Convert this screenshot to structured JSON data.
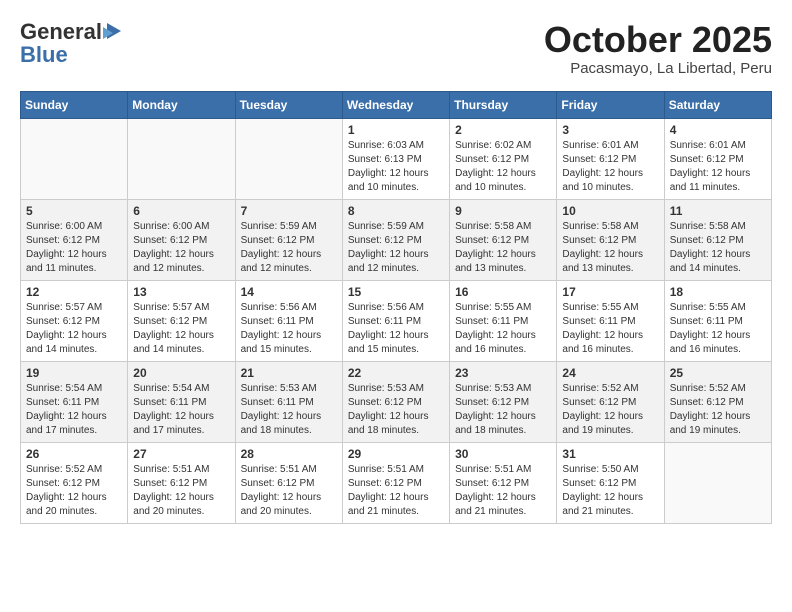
{
  "header": {
    "logo_general": "General",
    "logo_blue": "Blue",
    "month_title": "October 2025",
    "subtitle": "Pacasmayo, La Libertad, Peru"
  },
  "weekdays": [
    "Sunday",
    "Monday",
    "Tuesday",
    "Wednesday",
    "Thursday",
    "Friday",
    "Saturday"
  ],
  "weeks": [
    [
      {
        "day": "",
        "sunrise": "",
        "sunset": "",
        "daylight": ""
      },
      {
        "day": "",
        "sunrise": "",
        "sunset": "",
        "daylight": ""
      },
      {
        "day": "",
        "sunrise": "",
        "sunset": "",
        "daylight": ""
      },
      {
        "day": "1",
        "sunrise": "Sunrise: 6:03 AM",
        "sunset": "Sunset: 6:13 PM",
        "daylight": "Daylight: 12 hours and 10 minutes."
      },
      {
        "day": "2",
        "sunrise": "Sunrise: 6:02 AM",
        "sunset": "Sunset: 6:12 PM",
        "daylight": "Daylight: 12 hours and 10 minutes."
      },
      {
        "day": "3",
        "sunrise": "Sunrise: 6:01 AM",
        "sunset": "Sunset: 6:12 PM",
        "daylight": "Daylight: 12 hours and 10 minutes."
      },
      {
        "day": "4",
        "sunrise": "Sunrise: 6:01 AM",
        "sunset": "Sunset: 6:12 PM",
        "daylight": "Daylight: 12 hours and 11 minutes."
      }
    ],
    [
      {
        "day": "5",
        "sunrise": "Sunrise: 6:00 AM",
        "sunset": "Sunset: 6:12 PM",
        "daylight": "Daylight: 12 hours and 11 minutes."
      },
      {
        "day": "6",
        "sunrise": "Sunrise: 6:00 AM",
        "sunset": "Sunset: 6:12 PM",
        "daylight": "Daylight: 12 hours and 12 minutes."
      },
      {
        "day": "7",
        "sunrise": "Sunrise: 5:59 AM",
        "sunset": "Sunset: 6:12 PM",
        "daylight": "Daylight: 12 hours and 12 minutes."
      },
      {
        "day": "8",
        "sunrise": "Sunrise: 5:59 AM",
        "sunset": "Sunset: 6:12 PM",
        "daylight": "Daylight: 12 hours and 12 minutes."
      },
      {
        "day": "9",
        "sunrise": "Sunrise: 5:58 AM",
        "sunset": "Sunset: 6:12 PM",
        "daylight": "Daylight: 12 hours and 13 minutes."
      },
      {
        "day": "10",
        "sunrise": "Sunrise: 5:58 AM",
        "sunset": "Sunset: 6:12 PM",
        "daylight": "Daylight: 12 hours and 13 minutes."
      },
      {
        "day": "11",
        "sunrise": "Sunrise: 5:58 AM",
        "sunset": "Sunset: 6:12 PM",
        "daylight": "Daylight: 12 hours and 14 minutes."
      }
    ],
    [
      {
        "day": "12",
        "sunrise": "Sunrise: 5:57 AM",
        "sunset": "Sunset: 6:12 PM",
        "daylight": "Daylight: 12 hours and 14 minutes."
      },
      {
        "day": "13",
        "sunrise": "Sunrise: 5:57 AM",
        "sunset": "Sunset: 6:12 PM",
        "daylight": "Daylight: 12 hours and 14 minutes."
      },
      {
        "day": "14",
        "sunrise": "Sunrise: 5:56 AM",
        "sunset": "Sunset: 6:11 PM",
        "daylight": "Daylight: 12 hours and 15 minutes."
      },
      {
        "day": "15",
        "sunrise": "Sunrise: 5:56 AM",
        "sunset": "Sunset: 6:11 PM",
        "daylight": "Daylight: 12 hours and 15 minutes."
      },
      {
        "day": "16",
        "sunrise": "Sunrise: 5:55 AM",
        "sunset": "Sunset: 6:11 PM",
        "daylight": "Daylight: 12 hours and 16 minutes."
      },
      {
        "day": "17",
        "sunrise": "Sunrise: 5:55 AM",
        "sunset": "Sunset: 6:11 PM",
        "daylight": "Daylight: 12 hours and 16 minutes."
      },
      {
        "day": "18",
        "sunrise": "Sunrise: 5:55 AM",
        "sunset": "Sunset: 6:11 PM",
        "daylight": "Daylight: 12 hours and 16 minutes."
      }
    ],
    [
      {
        "day": "19",
        "sunrise": "Sunrise: 5:54 AM",
        "sunset": "Sunset: 6:11 PM",
        "daylight": "Daylight: 12 hours and 17 minutes."
      },
      {
        "day": "20",
        "sunrise": "Sunrise: 5:54 AM",
        "sunset": "Sunset: 6:11 PM",
        "daylight": "Daylight: 12 hours and 17 minutes."
      },
      {
        "day": "21",
        "sunrise": "Sunrise: 5:53 AM",
        "sunset": "Sunset: 6:11 PM",
        "daylight": "Daylight: 12 hours and 18 minutes."
      },
      {
        "day": "22",
        "sunrise": "Sunrise: 5:53 AM",
        "sunset": "Sunset: 6:12 PM",
        "daylight": "Daylight: 12 hours and 18 minutes."
      },
      {
        "day": "23",
        "sunrise": "Sunrise: 5:53 AM",
        "sunset": "Sunset: 6:12 PM",
        "daylight": "Daylight: 12 hours and 18 minutes."
      },
      {
        "day": "24",
        "sunrise": "Sunrise: 5:52 AM",
        "sunset": "Sunset: 6:12 PM",
        "daylight": "Daylight: 12 hours and 19 minutes."
      },
      {
        "day": "25",
        "sunrise": "Sunrise: 5:52 AM",
        "sunset": "Sunset: 6:12 PM",
        "daylight": "Daylight: 12 hours and 19 minutes."
      }
    ],
    [
      {
        "day": "26",
        "sunrise": "Sunrise: 5:52 AM",
        "sunset": "Sunset: 6:12 PM",
        "daylight": "Daylight: 12 hours and 20 minutes."
      },
      {
        "day": "27",
        "sunrise": "Sunrise: 5:51 AM",
        "sunset": "Sunset: 6:12 PM",
        "daylight": "Daylight: 12 hours and 20 minutes."
      },
      {
        "day": "28",
        "sunrise": "Sunrise: 5:51 AM",
        "sunset": "Sunset: 6:12 PM",
        "daylight": "Daylight: 12 hours and 20 minutes."
      },
      {
        "day": "29",
        "sunrise": "Sunrise: 5:51 AM",
        "sunset": "Sunset: 6:12 PM",
        "daylight": "Daylight: 12 hours and 21 minutes."
      },
      {
        "day": "30",
        "sunrise": "Sunrise: 5:51 AM",
        "sunset": "Sunset: 6:12 PM",
        "daylight": "Daylight: 12 hours and 21 minutes."
      },
      {
        "day": "31",
        "sunrise": "Sunrise: 5:50 AM",
        "sunset": "Sunset: 6:12 PM",
        "daylight": "Daylight: 12 hours and 21 minutes."
      },
      {
        "day": "",
        "sunrise": "",
        "sunset": "",
        "daylight": ""
      }
    ]
  ]
}
